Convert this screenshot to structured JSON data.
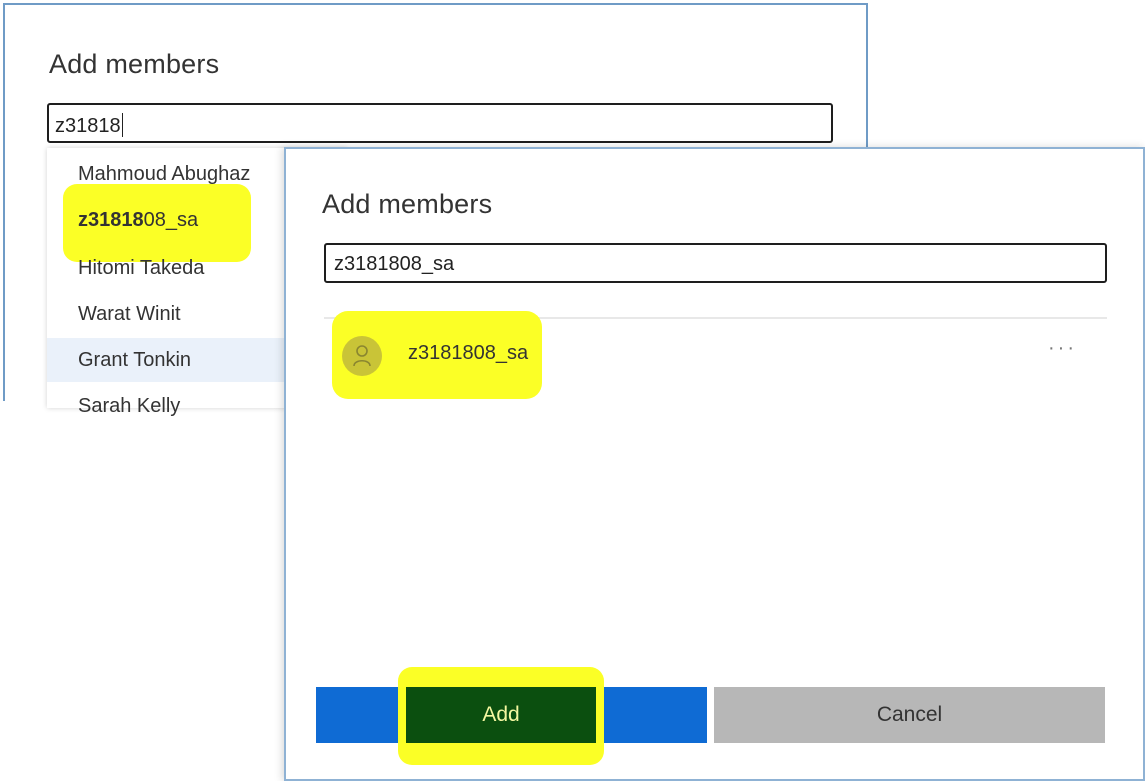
{
  "back_dialog": {
    "title": "Add members",
    "search_value": "z31818",
    "suggestions": [
      {
        "label": "Mahmoud Abughaz"
      },
      {
        "label_bold": "z31818",
        "label_rest": "08_sa",
        "highlighted": true
      },
      {
        "label": "Hitomi Takeda"
      },
      {
        "label": "Warat Winit"
      },
      {
        "label": "Grant Tonkin",
        "selected": true
      },
      {
        "label": "Sarah Kelly"
      }
    ]
  },
  "front_dialog": {
    "title": "Add members",
    "search_value": "z3181808_sa",
    "member": {
      "name": "z3181808_sa",
      "avatar_icon": "person-icon",
      "more_icon": "more-options-icon",
      "more_label": "···"
    },
    "buttons": {
      "add_label": "Add",
      "cancel_label": "Cancel"
    }
  },
  "colors": {
    "accent": "#0f6bd4",
    "highlight": "#fbff26",
    "add_dark": "#0b4f0f",
    "cancel": "#b7b7b7"
  }
}
